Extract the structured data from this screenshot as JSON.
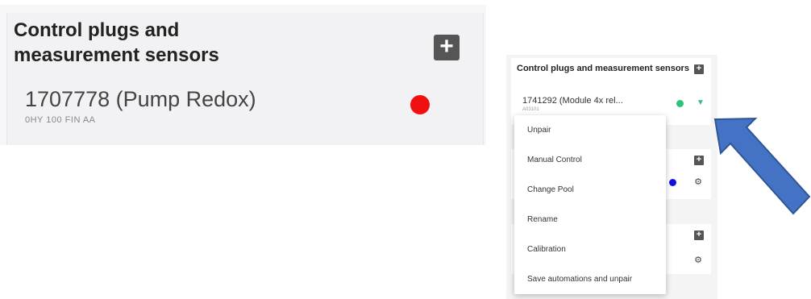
{
  "left": {
    "title": "Control plugs and measurement sensors",
    "add_icon": "plus-icon",
    "device_label": "1707778 (Pump Redox)",
    "device_subtitle": "0HY 100 FIN AA",
    "status_color": "#f01010"
  },
  "right": {
    "title": "Control plugs and measurement sensors",
    "device_label": "1741292 (Module 4x rel...",
    "device_subtitle": "A03101",
    "status_color": "#2ec27e",
    "second_status_color": "#1010e0",
    "wifi_icon": "wifi-icon",
    "gear_icon": "gear-icon",
    "menu": {
      "items": [
        "Unpair",
        "Manual Control",
        "Change Pool",
        "Rename",
        "Calibration",
        "Save automations and unpair"
      ]
    }
  },
  "annotation": {
    "arrow_color": "#4472c4"
  }
}
